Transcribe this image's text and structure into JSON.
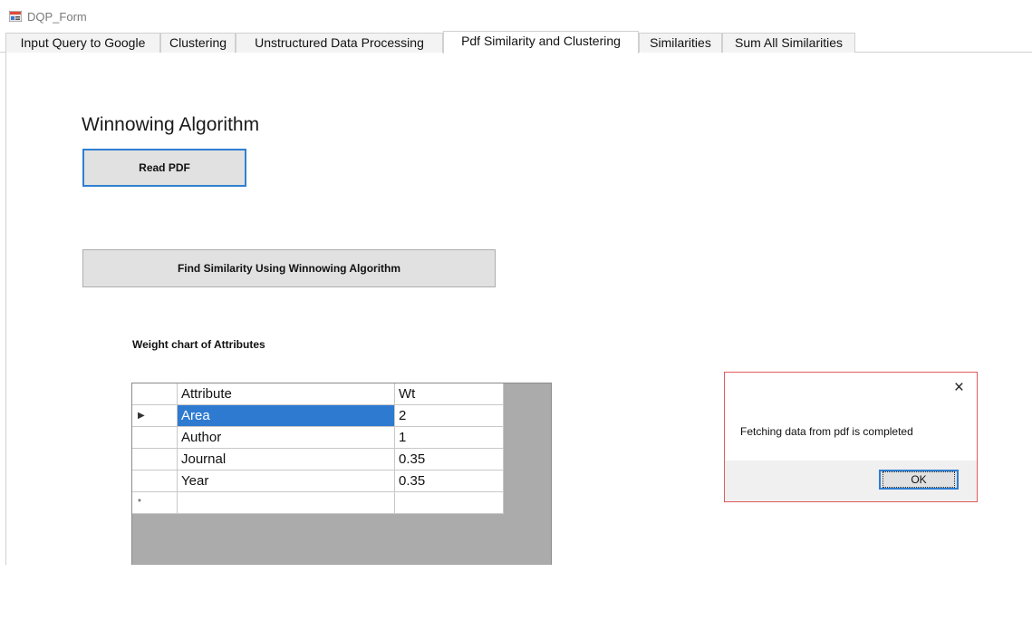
{
  "window": {
    "title": "DQP_Form"
  },
  "tabs": [
    {
      "label": "Input Query to Google",
      "active": false
    },
    {
      "label": "Clustering",
      "active": false
    },
    {
      "label": "Unstructured Data Processing",
      "active": false
    },
    {
      "label": "Pdf Similarity and Clustering",
      "active": true
    },
    {
      "label": "Similarities",
      "active": false
    },
    {
      "label": "Sum All Similarities",
      "active": false
    }
  ],
  "main": {
    "heading": "Winnowing Algorithm",
    "read_pdf_label": "Read PDF",
    "find_similarity_label": "Find Similarity Using Winnowing Algorithm",
    "chart_label": "Weight chart of Attributes"
  },
  "grid": {
    "columns": [
      "Attribute",
      "Wt"
    ],
    "rows": [
      {
        "attribute": "Area",
        "wt": "2"
      },
      {
        "attribute": "Author",
        "wt": "1"
      },
      {
        "attribute": "Journal",
        "wt": "0.35"
      },
      {
        "attribute": "Year",
        "wt": "0.35"
      }
    ],
    "current_row_glyph": "▶",
    "new_row_glyph": "*"
  },
  "dialog": {
    "message": "Fetching data from pdf is completed",
    "ok_label": "OK",
    "close_glyph": "×"
  },
  "colors": {
    "accent": "#2f7fd1",
    "selection": "#2e7ad1",
    "dialog_border": "#e35b5b",
    "grid_background": "#ababab"
  },
  "icons": {
    "app": "form-window-icon",
    "close": "close-icon",
    "current_row": "current-row-arrow-icon",
    "new_row": "new-row-asterisk-icon"
  }
}
